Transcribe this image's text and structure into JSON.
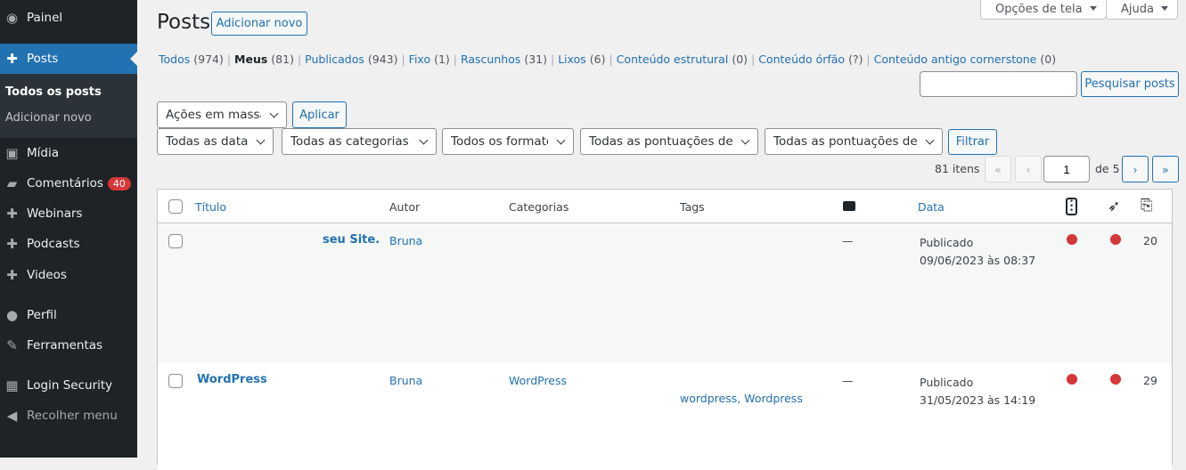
{
  "sidebar": {
    "items": [
      {
        "label": "Painel",
        "icon": "dashboard-icon",
        "glyph": "◉"
      },
      {
        "label": "Posts",
        "icon": "pin-icon",
        "glyph": "✚",
        "active": true
      },
      {
        "label": "Mídia",
        "icon": "media-icon",
        "glyph": "▣"
      },
      {
        "label": "Comentários",
        "icon": "comment-icon",
        "glyph": "▰",
        "badge": "40"
      },
      {
        "label": "Webinars",
        "icon": "pin-icon",
        "glyph": "✚"
      },
      {
        "label": "Podcasts",
        "icon": "pin-icon",
        "glyph": "✚"
      },
      {
        "label": "Videos",
        "icon": "pin-icon",
        "glyph": "✚"
      },
      {
        "label": "Perfil",
        "icon": "user-icon",
        "glyph": "●"
      },
      {
        "label": "Ferramentas",
        "icon": "wrench-icon",
        "glyph": "✎"
      },
      {
        "label": "Login Security",
        "icon": "security-icon",
        "glyph": "▦"
      },
      {
        "label": "Recolher menu",
        "icon": "collapse-icon",
        "glyph": "◀"
      }
    ],
    "submenu": [
      "Todos os posts",
      "Adicionar novo"
    ]
  },
  "header": {
    "title": "Posts",
    "add_new": "Adicionar novo",
    "screen_options": "Opções de tela",
    "help": "Ajuda"
  },
  "views": [
    {
      "label": "Todos",
      "count": "(974)"
    },
    {
      "label": "Meus",
      "count": "(81)",
      "current": true
    },
    {
      "label": "Publicados",
      "count": "(943)"
    },
    {
      "label": "Fixo",
      "count": "(1)"
    },
    {
      "label": "Rascunhos",
      "count": "(31)"
    },
    {
      "label": "Lixos",
      "count": "(6)"
    },
    {
      "label": "Conteúdo estrutural",
      "count": "(0)"
    },
    {
      "label": "Conteúdo órfão",
      "count": "(?)"
    },
    {
      "label": "Conteúdo antigo cornerstone",
      "count": "(0)"
    }
  ],
  "search": {
    "value": "",
    "button": "Pesquisar posts"
  },
  "bulk": {
    "selected": "Ações em massa",
    "apply": "Aplicar"
  },
  "filters": {
    "dates": "Todas as datas",
    "categories": "Todas as categorias",
    "formats": "Todos os formatos",
    "seo": "Todas as pontuações de SEO",
    "readability": "Todas as pontuações de legibilidade",
    "button": "Filtrar"
  },
  "pagination": {
    "items": "81 itens",
    "first": "«",
    "prev": "‹",
    "current": "1",
    "of": "de 5",
    "next": "›",
    "last": "»"
  },
  "table": {
    "columns": {
      "title": "Título",
      "author": "Autor",
      "categories": "Categorias",
      "tags": "Tags",
      "comments_icon": "comment-icon",
      "date": "Data",
      "seo_icon": "seo-traffic-light-icon",
      "readability_icon": "feather-icon",
      "links_icon": "internal-links-icon"
    },
    "rows": [
      {
        "title": "seu Site.",
        "author": "Bruna",
        "categories": "",
        "tags": "",
        "comments": "—",
        "status": "Publicado",
        "date": "09/06/2023 às 08:37",
        "seo_color": "#d63638",
        "readability_color": "#d63638",
        "links": "20"
      },
      {
        "title": "WordPress",
        "author": "Bruna",
        "categories": "WordPress",
        "tags": "wordpress, Wordpress",
        "comments": "—",
        "status": "Publicado",
        "date": "31/05/2023 às 14:19",
        "seo_color": "#d63638",
        "readability_color": "#d63638",
        "links": "29"
      }
    ]
  }
}
